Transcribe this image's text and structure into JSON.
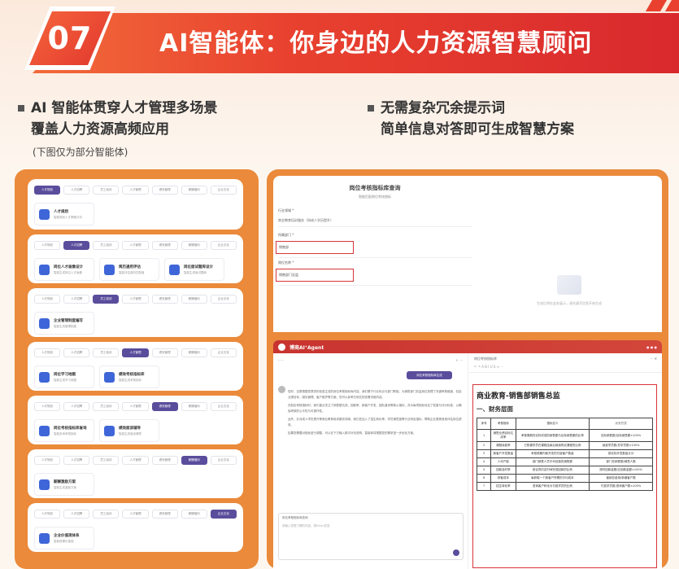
{
  "banner": {
    "number": "07",
    "title": "AI智能体：你身边的人力资源智慧顾问"
  },
  "left_heading": {
    "line1": "AI 智能体贯穿人才管理多场景",
    "line2": "覆盖人力资源高频应用",
    "note": "(下图仅为部分智能体)"
  },
  "right_heading": {
    "line1": "无需复杂冗余提示词",
    "line2": "简单信息对答即可生成智慧方案"
  },
  "colors": {
    "accent": "#e8412f",
    "panel": "#ea8a3a",
    "primary": "#5a4d9c"
  },
  "tabs": [
    "人才规划",
    "人才招聘",
    "员工培训",
    "人才管理",
    "绩效管理",
    "薪酬福利",
    "企业文化"
  ],
  "cards": [
    {
      "active": 0,
      "agents": [
        {
          "name": "人才规划",
          "desc": "智能规划人才策略方向"
        }
      ]
    },
    {
      "active": 1,
      "agents": [
        {
          "name": "岗位人才画像设计",
          "desc": "智能生成岗位人才画像"
        },
        {
          "name": "简历通用评估",
          "desc": "智能评估简历匹配度"
        },
        {
          "name": "岗位面试题库设计",
          "desc": "智能生成面试题库"
        }
      ]
    },
    {
      "active": 2,
      "agents": [
        {
          "name": "企业管理制度编写",
          "desc": "智能生成管理制度"
        }
      ]
    },
    {
      "active": 3,
      "agents": [
        {
          "name": "岗位学习地图",
          "desc": "智能生成学习地图"
        },
        {
          "name": "绩效考核指标库",
          "desc": "智能生成考核指标"
        }
      ]
    },
    {
      "active": 4,
      "agents": [
        {
          "name": "岗位考核指标库查询",
          "desc": "智能查询考核指标"
        },
        {
          "name": "绩效面谈辅导",
          "desc": "智能生成面谈辅导"
        }
      ]
    },
    {
      "active": 5,
      "agents": [
        {
          "name": "薪酬激励方案",
          "desc": "智能生成激励方案"
        }
      ]
    },
    {
      "active": 6,
      "agents": [
        {
          "name": "企业价值观体系",
          "desc": "智能梳理价值观"
        }
      ]
    }
  ],
  "form": {
    "title": "岗位考核指标库查询",
    "subtitle": "智能匹配岗位考核指标",
    "field1_label": "行业领域 *",
    "field1_value": "商业教育培训服务（如成人学历提升）",
    "field2_label": "所属部门 *",
    "field2_value": "销售部",
    "field3_label": "岗位名称 *",
    "field3_value": "销售部门总监",
    "empty_text": "生成后将在此处展示，请先填写信息开始生成"
  },
  "agent_window": {
    "brand": "博商AI⁺Agent",
    "generate_button": "岗位考核指标库生成",
    "chat_paragraphs": [
      "您好，这是根据您提供的信息生成的岗位考核指标库内容。我们基于行业特点与部门职能，为销售部门总监岗位梳理了关键考核维度，包括业绩目标、团队管理、客户维护等方面，您可以参考右侧文档查看详细内容。",
      "在制定考核指标时，我们重点关注了销售额达成、回款率、新客户开发、团队建设等核心指标，并为每项指标设定了权重与评分标准，以确保考核的公平性与可操作性。",
      "此外，针对成人学历提升等商业教育培训服务领域，我们还加入了招生转化率、学员满意度等行业特色指标，帮助企业更精准地评估岗位绩效。",
      "如果您需要对指标进行调整，可以在下方输入框中补充说明，智能体将根据您的需求进一步优化方案。"
    ],
    "input_label": "岗位考核指标库查询",
    "input_placeholder": "请输入您想了解的内容，按Enter发送",
    "doc_header": "岗位考核指标库",
    "doc_title": "商业教育-销售部销售总监",
    "doc_section": "一、财务层面",
    "table_headers": [
      "序号",
      "考核指标",
      "指标定义",
      "计分方式"
    ],
    "table_rows": [
      [
        "1",
        "销售业绩目标达成率",
        "考核周期内实际完成的销售额与目标销售额的比率",
        "实际销售额/目标销售额×100%"
      ],
      [
        "2",
        "课程续费率",
        "已购课学员在课程结束后继续购买课程的比例",
        "续费学员数/总学员数×100%"
      ],
      [
        "3",
        "新客户开发数量",
        "考核周期内新开发的付费客户数量",
        "按实际开发数量计分"
      ],
      [
        "4",
        "人均产能",
        "部门销售人员平均创造的销售额",
        "部门总销售额/销售人数"
      ],
      [
        "5",
        "回款及时率",
        "按合同约定时间完成回款的比例",
        "按时回款金额/应回款金额×100%"
      ],
      [
        "6",
        "获客成本",
        "每获取一个新客户所需的平均成本",
        "营销总费用/新增客户数"
      ],
      [
        "7",
        "招生转化率",
        "咨询客户转化为付费学员的比例",
        "付费学员数/咨询客户数×100%"
      ]
    ]
  }
}
